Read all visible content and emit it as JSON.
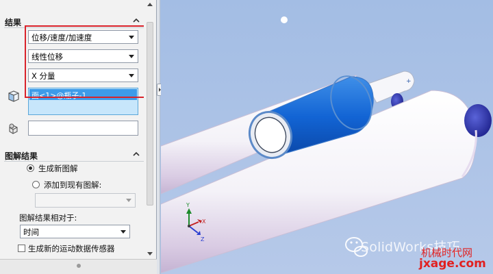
{
  "results": {
    "title": "结果",
    "combo_type": "位移/速度/加速度",
    "combo_subtype": "线性位移",
    "combo_component": "X 分量",
    "selected_item": "面<1>@瓶子-1"
  },
  "plot_results": {
    "title": "图解结果",
    "radio_new": "生成新图解",
    "radio_add": "添加到现有图解:",
    "relative_label": "图解结果相对于:",
    "relative_value": "时间",
    "checkbox_sensor": "生成新的运动数据传感器"
  },
  "triad": {
    "x": "X",
    "y": "Y",
    "z": "Z"
  },
  "watermark": {
    "brand": "SolidWorks技巧",
    "site1": "机械时代网",
    "site2": "jxage.com"
  },
  "colors": {
    "panel_bg": "#f2f2f2",
    "viewport_bg": "#a9c1e4",
    "highlight_red": "#d9222a",
    "selection_blue": "#3d9be9",
    "face_blue": "#1a6fd8"
  }
}
